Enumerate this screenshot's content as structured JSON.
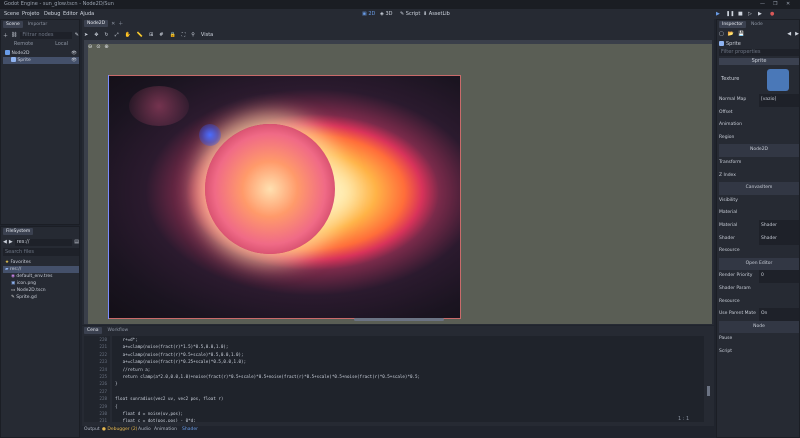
{
  "window": {
    "title": "Godot Engine - sun_glow.tscn - Node2D/Sun",
    "controls": [
      "—",
      "❐",
      "✕"
    ]
  },
  "menu": [
    "Scene",
    "Projeto",
    "Debug",
    "Editor",
    "Ajuda"
  ],
  "workspaces": [
    "2D",
    "3D",
    "Script",
    "AssetLib"
  ],
  "scene_dock": {
    "tabs": [
      "Scene",
      "Importar"
    ],
    "filter_placeholder": "Filtrar nodes",
    "subtabs": [
      "Remote",
      "Local"
    ],
    "nodes": [
      {
        "name": "Node2D",
        "depth": 0,
        "selected": false
      },
      {
        "name": "Sprite",
        "depth": 1,
        "selected": true
      }
    ]
  },
  "filesystem": {
    "tab": "FileSystem",
    "path": "res://",
    "search_placeholder": "Search files",
    "items": [
      {
        "name": "Favorites",
        "depth": 0,
        "selected": false
      },
      {
        "name": "res://",
        "depth": 0,
        "selected": true
      },
      {
        "name": "default_env.tres",
        "depth": 1,
        "selected": false
      },
      {
        "name": "icon.png",
        "depth": 1,
        "selected": false
      },
      {
        "name": "Node2D.tscn",
        "depth": 1,
        "selected": false
      },
      {
        "name": "Sprite.gd",
        "depth": 1,
        "selected": false
      }
    ]
  },
  "viewport": {
    "tab": "Node2D",
    "toolbar_label": "Vista"
  },
  "code": {
    "tabs": [
      "Cena",
      "Workflow"
    ],
    "lines": [
      {
        "n": "220",
        "text": "   r+=d*;"
      },
      {
        "n": "221",
        "text": "   a+=clamp(noise(fract(r)*1.5)*0.5,0.0,1.0);"
      },
      {
        "n": "222",
        "text": "   a+=clamp(noise(fract(r)*0.5+scale)*0.5,0.0,1.0);"
      },
      {
        "n": "223",
        "text": "   a+=clamp(noise(fract(r)*0.25+scale)*0.5,0.0,1.0);"
      },
      {
        "n": "224",
        "text": "   //return a;"
      },
      {
        "n": "225",
        "text": "   return clamp(a*2.0,0.0,1.0)+noise(fract(r)*0.5+scale)*0.5+noise(fract(r)*0.5+scale)*0.5+noise(fract(r)*0.5+scale)*0.5;"
      },
      {
        "n": "226",
        "text": "}"
      },
      {
        "n": "227",
        "text": ""
      },
      {
        "n": "228",
        "text": "float sunradius(vec2 uv, vec2 pos, float r)"
      },
      {
        "n": "229",
        "text": "{"
      },
      {
        "n": "230",
        "text": "   float d = noise(uv,pos);"
      },
      {
        "n": "231",
        "text": "   float c = dot(pos,pos) - 0*d;"
      },
      {
        "n": "232",
        "text": "   float b=1.0;"
      }
    ],
    "cursor_pos": "1 : 1"
  },
  "bottom_tabs": [
    "Output",
    "Debugger (2)",
    "Audio",
    "Animation",
    "Shader"
  ],
  "inspector": {
    "tabs": [
      "Inspector",
      "Node"
    ],
    "node_name": "Sprite",
    "filter_placeholder": "Filter properties",
    "rows": [
      {
        "label": "Texture",
        "value": ""
      },
      {
        "label": "Normal Map",
        "value": "[vazio]"
      },
      {
        "label": "Offset",
        "value": ""
      },
      {
        "label": "Animation",
        "value": ""
      },
      {
        "label": "Region",
        "value": ""
      },
      {
        "label": "",
        "value": "Node2D"
      },
      {
        "label": "Transform",
        "value": ""
      },
      {
        "label": "Z Index",
        "value": ""
      },
      {
        "label": "",
        "value": "CanvasItem"
      },
      {
        "label": "Visibility",
        "value": ""
      },
      {
        "label": "Material",
        "value": ""
      },
      {
        "label": "Material",
        "value": "Shader"
      },
      {
        "label": "Shader",
        "value": "Shader"
      },
      {
        "label": "Resource",
        "value": ""
      },
      {
        "label": "",
        "value": "Open Editor"
      },
      {
        "label": "Render Priority",
        "value": "0"
      },
      {
        "label": "Shader Param",
        "value": ""
      },
      {
        "label": "Resource",
        "value": ""
      },
      {
        "label": "Use Parent Mate",
        "value": "On"
      },
      {
        "label": "",
        "value": "Node"
      },
      {
        "label": "Pause",
        "value": ""
      },
      {
        "label": "Script",
        "value": ""
      }
    ]
  },
  "colors": {
    "panel": "#262a33",
    "accent": "#699ce8",
    "selection": "#44506a"
  }
}
